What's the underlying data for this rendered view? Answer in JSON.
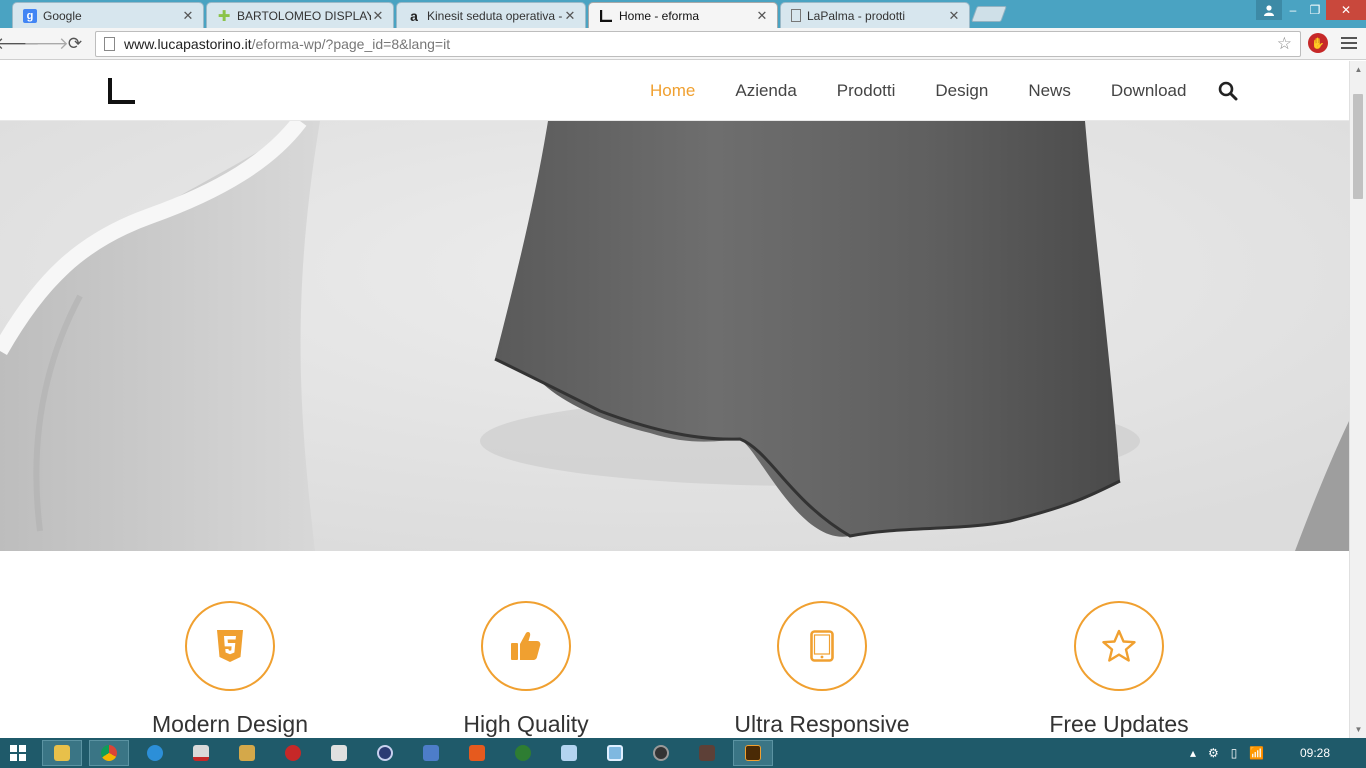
{
  "browser": {
    "tabs": [
      {
        "title": "Google",
        "favicon": "google-icon",
        "active": false
      },
      {
        "title": "BARTOLOMEO DISPLAY |",
        "favicon": "cross-icon",
        "active": false
      },
      {
        "title": "Kinesit seduta operativa -",
        "favicon": "amazon-icon",
        "active": false
      },
      {
        "title": "Home - eforma",
        "favicon": "eforma-icon",
        "active": true
      },
      {
        "title": "LaPalma - prodotti",
        "favicon": "page-icon",
        "active": false
      }
    ],
    "url_host": "www.lucapastorino.it",
    "url_path": "/eforma-wp/?page_id=8&lang=it"
  },
  "site": {
    "nav": [
      {
        "label": "Home",
        "active": true
      },
      {
        "label": "Azienda",
        "active": false
      },
      {
        "label": "Prodotti",
        "active": false
      },
      {
        "label": "Design",
        "active": false
      },
      {
        "label": "News",
        "active": false
      },
      {
        "label": "Download",
        "active": false
      }
    ],
    "features": [
      {
        "title": "Modern Design",
        "icon": "html5-icon"
      },
      {
        "title": "High Quality",
        "icon": "thumbs-up-icon"
      },
      {
        "title": "Ultra Responsive",
        "icon": "tablet-icon"
      },
      {
        "title": "Free Updates",
        "icon": "star-icon"
      }
    ],
    "accent": "#f0a030"
  },
  "taskbar": {
    "clock": "09:28"
  }
}
